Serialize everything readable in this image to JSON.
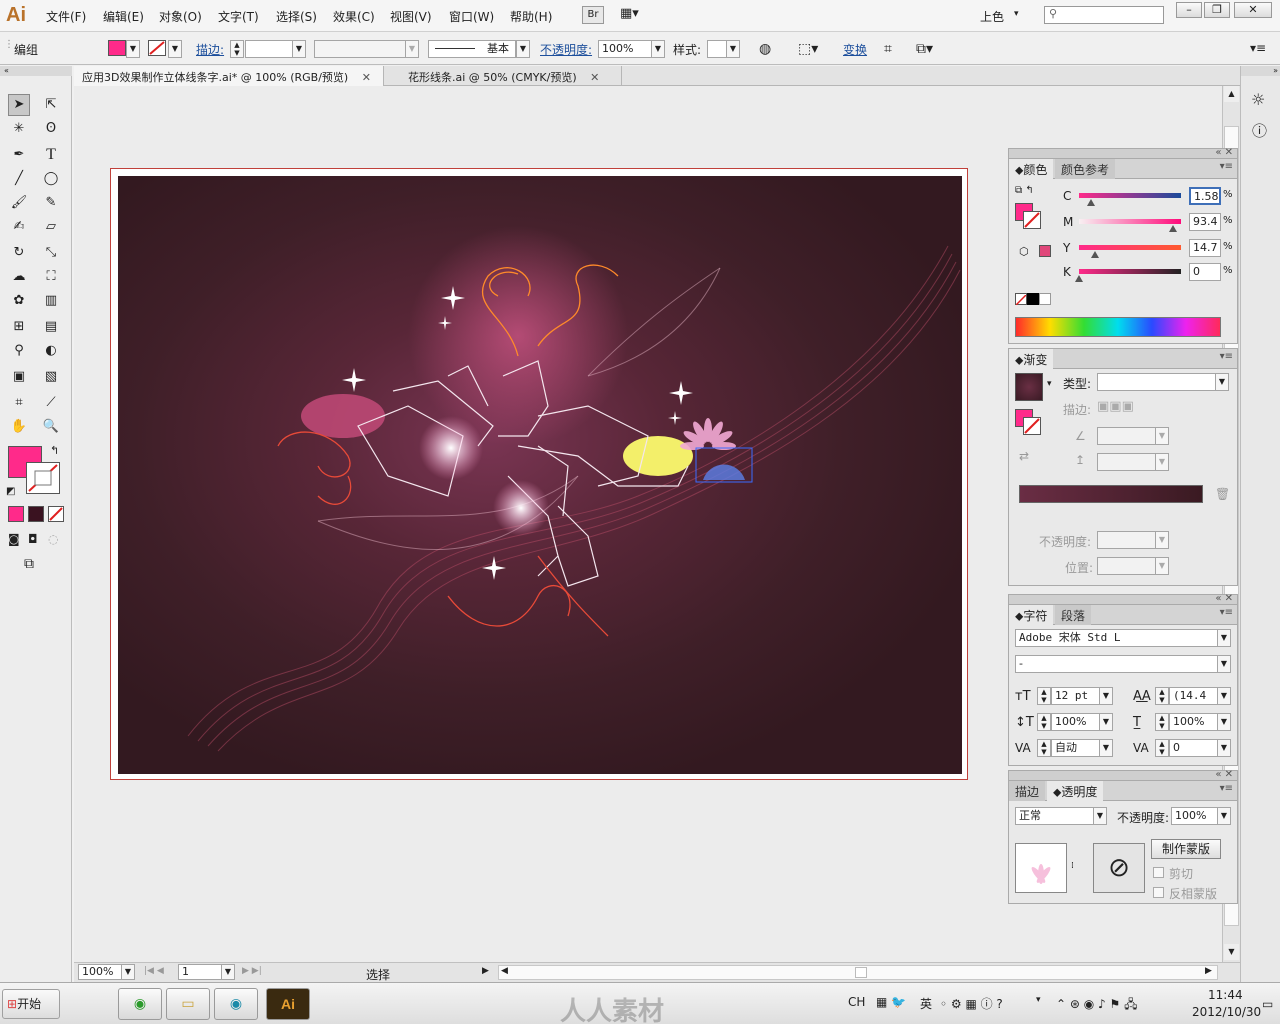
{
  "app": {
    "logo": "Ai",
    "title_workspace": "上色"
  },
  "menu": [
    "文件(F)",
    "编辑(E)",
    "对象(O)",
    "文字(T)",
    "选择(S)",
    "效果(C)",
    "视图(V)",
    "窗口(W)",
    "帮助(H)"
  ],
  "menubar_extra": {
    "bridge_label": "Br",
    "search_placeholder": ""
  },
  "control": {
    "selection_type": "编组",
    "stroke_label": "描边:",
    "stroke_style": "基本",
    "opacity_label": "不透明度:",
    "opacity_value": "100%",
    "style_label": "样式:",
    "transform_label": "变换",
    "fill_color": "#ff2a8a"
  },
  "tabs": [
    {
      "label": "应用3D效果制作立体线条字.ai* @ 100% (RGB/预览)",
      "active": true
    },
    {
      "label": "花形线条.ai @ 50% (CMYK/预览)",
      "active": false
    }
  ],
  "toolbox": {
    "tools": [
      "selection-tool",
      "direct-selection-tool",
      "magic-wand-tool",
      "lasso-tool",
      "pen-tool",
      "type-tool",
      "line-tool",
      "ellipse-tool",
      "paintbrush-tool",
      "pencil-tool",
      "blob-brush-tool",
      "eraser-tool",
      "rotate-tool",
      "scale-tool",
      "warp-tool",
      "free-transform-tool",
      "symbol-sprayer-tool",
      "column-graph-tool",
      "mesh-tool",
      "gradient-tool",
      "eyedropper-tool",
      "blend-tool",
      "live-paint-tool",
      "live-paint-select-tool",
      "artboard-tool",
      "slice-tool",
      "hand-tool",
      "zoom-tool"
    ],
    "fill_color": "#ff2a8a"
  },
  "status": {
    "zoom": "100%",
    "page": "1",
    "mode": "选择"
  },
  "color_panel": {
    "tabs": [
      "颜色",
      "颜色参考"
    ],
    "channels": [
      {
        "name": "C",
        "value": "1.58",
        "pos": 0.02
      },
      {
        "name": "M",
        "value": "93.4",
        "pos": 0.93
      },
      {
        "name": "Y",
        "value": "14.7",
        "pos": 0.15
      },
      {
        "name": "K",
        "value": "0",
        "pos": 0.0
      }
    ],
    "percent": "%"
  },
  "gradient_panel": {
    "title": "渐变",
    "type_label": "类型:",
    "stroke_label": "描边:",
    "opacity_label": "不透明度:",
    "location_label": "位置:"
  },
  "character_panel": {
    "tabs": [
      "字符",
      "段落"
    ],
    "font": "Adobe 宋体 Std L",
    "style": "-",
    "size": "12 pt",
    "leading": "(14.4",
    "vscale": "100%",
    "hscale": "100%",
    "kerning": "自动",
    "tracking": "0"
  },
  "transparency_panel": {
    "tabs": [
      "描边",
      "透明度"
    ],
    "blend_mode": "正常",
    "opacity_label": "不透明度:",
    "opacity_value": "100%",
    "make_mask": "制作蒙版",
    "clip": "剪切",
    "invert_mask": "反相蒙版"
  },
  "taskbar": {
    "start": "开始",
    "lang": "CH",
    "ime": "英",
    "time": "11:44",
    "date": "2012/10/30",
    "watermark": "人人素材"
  }
}
